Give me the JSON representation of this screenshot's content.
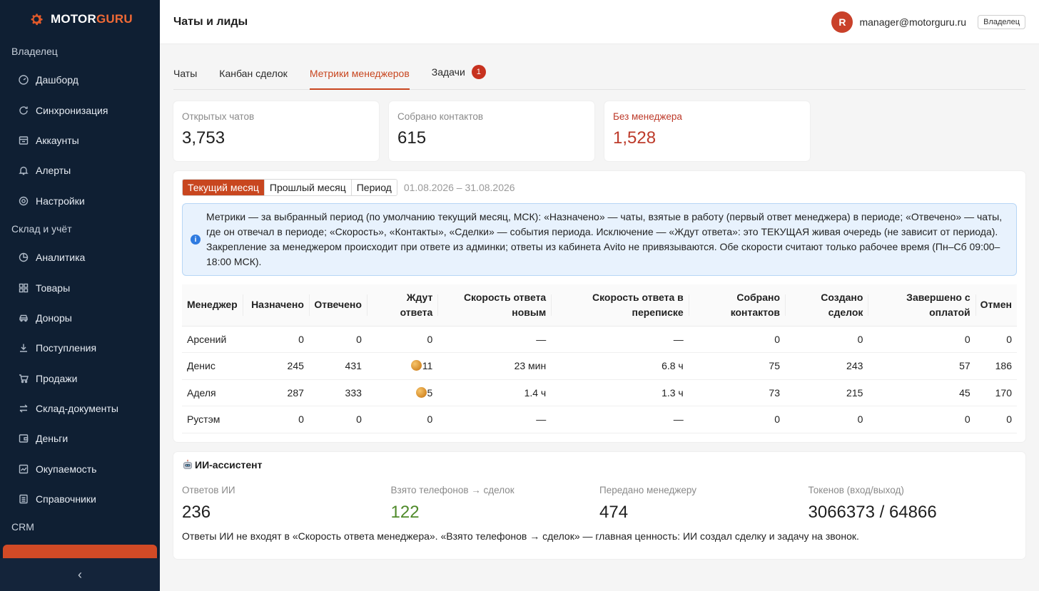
{
  "brand": {
    "part1": "MOTOR",
    "part2": "GURU"
  },
  "sidebar": {
    "groups": [
      {
        "title": "Владелец",
        "items": [
          "Дашборд",
          "Синхронизация",
          "Аккаунты",
          "Алерты",
          "Настройки"
        ]
      },
      {
        "title": "Склад и учёт",
        "items": [
          "Аналитика",
          "Товары",
          "Доноры",
          "Поступления",
          "Продажи",
          "Склад-документы",
          "Деньги",
          "Окупаемость",
          "Справочники"
        ]
      },
      {
        "title": "CRM"
      }
    ],
    "collapse_icon": "chevron-left-icon"
  },
  "header": {
    "title": "Чаты и лиды",
    "avatar_letter": "R",
    "email": "manager@motorguru.ru",
    "role": "Владелец"
  },
  "tabs": [
    {
      "label": "Чаты"
    },
    {
      "label": "Канбан сделок"
    },
    {
      "label": "Метрики менеджеров",
      "active": true
    },
    {
      "label": "Задачи",
      "badge": "1"
    }
  ],
  "stats": [
    {
      "label": "Открытых чатов",
      "value": "3,753"
    },
    {
      "label": "Собрано контактов",
      "value": "615"
    },
    {
      "label": "Без менеджера",
      "value": "1,528",
      "accent": "#bd3a2a"
    }
  ],
  "period": {
    "options": [
      "Текущий месяц",
      "Прошлый месяц",
      "Период"
    ],
    "selected": "Текущий месяц",
    "range": "01.08.2026 – 31.08.2026"
  },
  "info_text": "Метрики — за выбранный период (по умолчанию текущий месяц, МСК): «Назначено» — чаты, взятые в работу (первый ответ менеджера) в периоде; «Отвечено» — чаты, где он отвечал в периоде; «Скорость», «Контакты», «Сделки» — события периода. Исключение — «Ждут ответа»: это ТЕКУЩАЯ живая очередь (не зависит от периода). Закрепление за менеджером происходит при ответе из админки; ответы из кабинета Avito не привязываются. Обе скорости считают только рабочее время (Пн–Сб 09:00–18:00 МСК).",
  "table": {
    "headers": [
      "Менеджер",
      "Назначено",
      "Отвечено",
      "Ждут ответа",
      "Скорость ответа новым",
      "Скорость ответа в переписке",
      "Собрано контактов",
      "Создано сделок",
      "Завершено с оплатой",
      "Отмен"
    ],
    "rows": [
      [
        "Арсений",
        "0",
        "0",
        "0",
        "—",
        "—",
        "0",
        "0",
        "0",
        "0"
      ],
      [
        "Денис",
        "245",
        "431",
        "11",
        "23 мин",
        "6.8 ч",
        "75",
        "243",
        "57",
        "186"
      ],
      [
        "Аделя",
        "287",
        "333",
        "5",
        "1.4 ч",
        "1.3 ч",
        "73",
        "215",
        "45",
        "170"
      ],
      [
        "Рустэм",
        "0",
        "0",
        "0",
        "—",
        "—",
        "0",
        "0",
        "0",
        "0"
      ]
    ]
  },
  "ai": {
    "title": "ИИ-ассистент",
    "stats": [
      {
        "label": "Ответов ИИ",
        "value": "236"
      },
      {
        "label": "Взято телефонов → сделок",
        "value": "122",
        "accent": "#4f8a2a"
      },
      {
        "label": "Передано менеджеру",
        "value": "474"
      },
      {
        "label": "Токенов (вход/выход)",
        "value": "3066373 / 64866"
      }
    ],
    "note": "Ответы ИИ не входят в «Скорость ответа менеджера». «Взято телефонов → сделок» — главная ценность: ИИ создал сделку и задачу на звонок."
  },
  "colors": {
    "accent": "#c8461f",
    "sidebar_bg": "#0f1f33",
    "danger": "#bd3a2a",
    "success": "#4f8a2a",
    "info_bg": "#e8f2fd"
  }
}
